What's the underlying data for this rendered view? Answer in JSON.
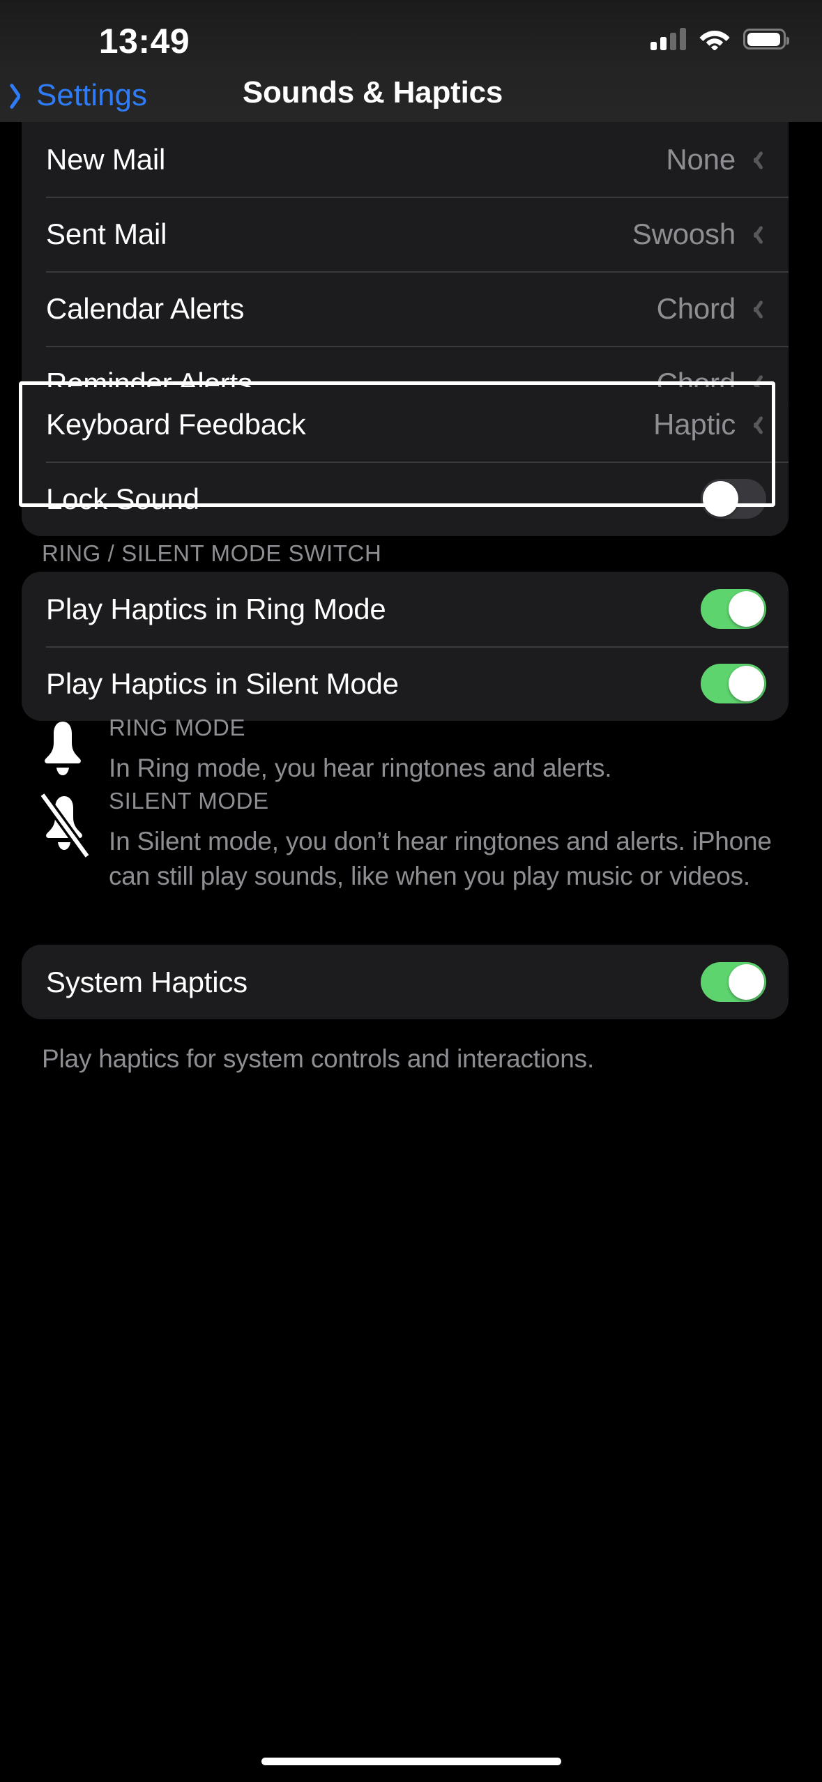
{
  "status_bar": {
    "time": "13:49",
    "cellular_icon": "cellular-signal-icon",
    "wifi_icon": "wifi-icon",
    "battery_icon": "battery-icon"
  },
  "nav": {
    "back_label": "Settings",
    "back_icon": "chevron-left-icon",
    "title": "Sounds & Haptics"
  },
  "colors": {
    "accent_blue": "#2f7cf6",
    "toggle_on_green": "#5ed46e",
    "toggle_off_gray": "#39393d",
    "card_background": "#1c1c1e",
    "secondary_text": "#8e8e93",
    "highlight_border": "#ffffff"
  },
  "groups": {
    "alert_sounds": {
      "rows": [
        {
          "label": "New Mail",
          "value": "None",
          "accessory": "chevron-right-icon"
        },
        {
          "label": "Sent Mail",
          "value": "Swoosh",
          "accessory": "chevron-right-icon"
        },
        {
          "label": "Calendar Alerts",
          "value": "Chord",
          "accessory": "chevron-right-icon"
        },
        {
          "label": "Reminder Alerts",
          "value": "Chord",
          "accessory": "chevron-right-icon"
        }
      ]
    },
    "keyboard_lock": {
      "highlighted": true,
      "rows": [
        {
          "label": "Keyboard Feedback",
          "value": "Haptic",
          "accessory": "chevron-right-icon"
        },
        {
          "label": "Lock Sound",
          "control": "toggle",
          "toggle_state": "off"
        }
      ]
    },
    "ring_silent": {
      "header": "RING / SILENT MODE SWITCH",
      "rows": [
        {
          "label": "Play Haptics in Ring Mode",
          "control": "toggle",
          "toggle_state": "on"
        },
        {
          "label": "Play Haptics in Silent Mode",
          "control": "toggle",
          "toggle_state": "on"
        }
      ]
    },
    "system_haptics": {
      "rows": [
        {
          "label": "System Haptics",
          "control": "toggle",
          "toggle_state": "on"
        }
      ],
      "footer": "Play haptics for system controls and interactions."
    }
  },
  "mode_info": [
    {
      "icon": "bell-icon",
      "title": "RING MODE",
      "body": "In Ring mode, you hear ringtones and alerts."
    },
    {
      "icon": "bell-slash-icon",
      "title": "SILENT MODE",
      "body": "In Silent mode, you don’t hear ringtones and alerts. iPhone can still play sounds, like when you play music or videos."
    }
  ]
}
